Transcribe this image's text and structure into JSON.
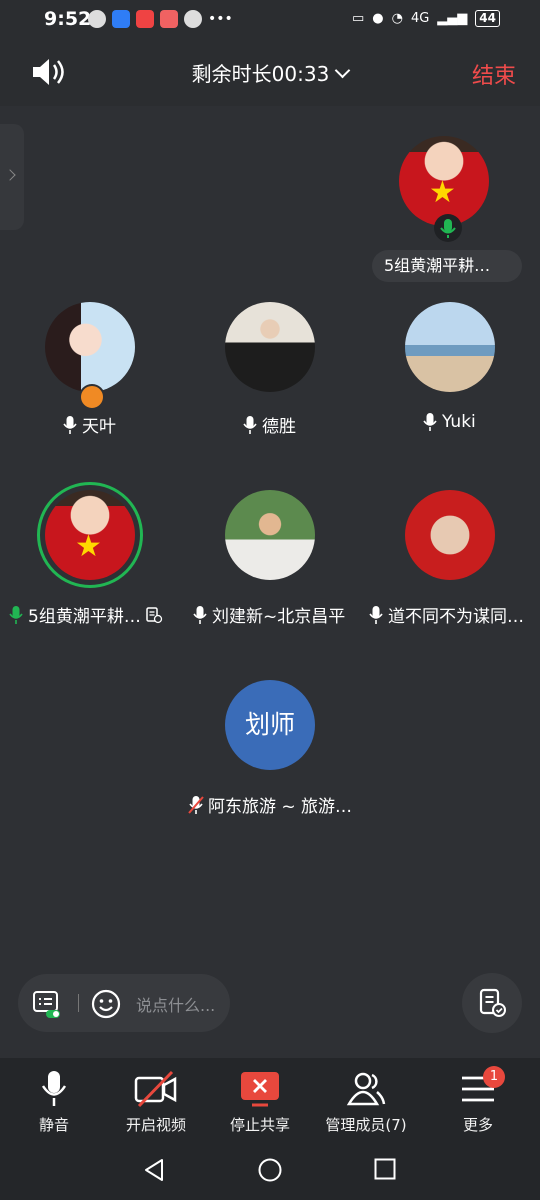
{
  "status": {
    "time": "9:52",
    "battery": "44",
    "network": "4G"
  },
  "header": {
    "timer_label": "剩余时长00:33",
    "end_label": "结束"
  },
  "participants": {
    "host_name": "5组黄潮平耕…",
    "tile_1": "天叶",
    "tile_2": "德胜",
    "tile_3": "Yuki",
    "tile_4": "5组黄潮平耕…",
    "tile_5": "刘建新~北京昌平",
    "tile_6": "道不同不为谋同…",
    "tile_7_initials": "划师",
    "tile_7": "阿东旅游 ~ 旅游…"
  },
  "chat": {
    "placeholder": "说点什么..."
  },
  "toolbar": {
    "mute": "静音",
    "video": "开启视频",
    "share": "停止共享",
    "members": "管理成员(7)",
    "more": "更多",
    "more_badge": "1"
  },
  "colors": {
    "accent_green": "#21b653",
    "end_red": "#ef4b4b",
    "avatar_blue": "#3a6cb8"
  }
}
